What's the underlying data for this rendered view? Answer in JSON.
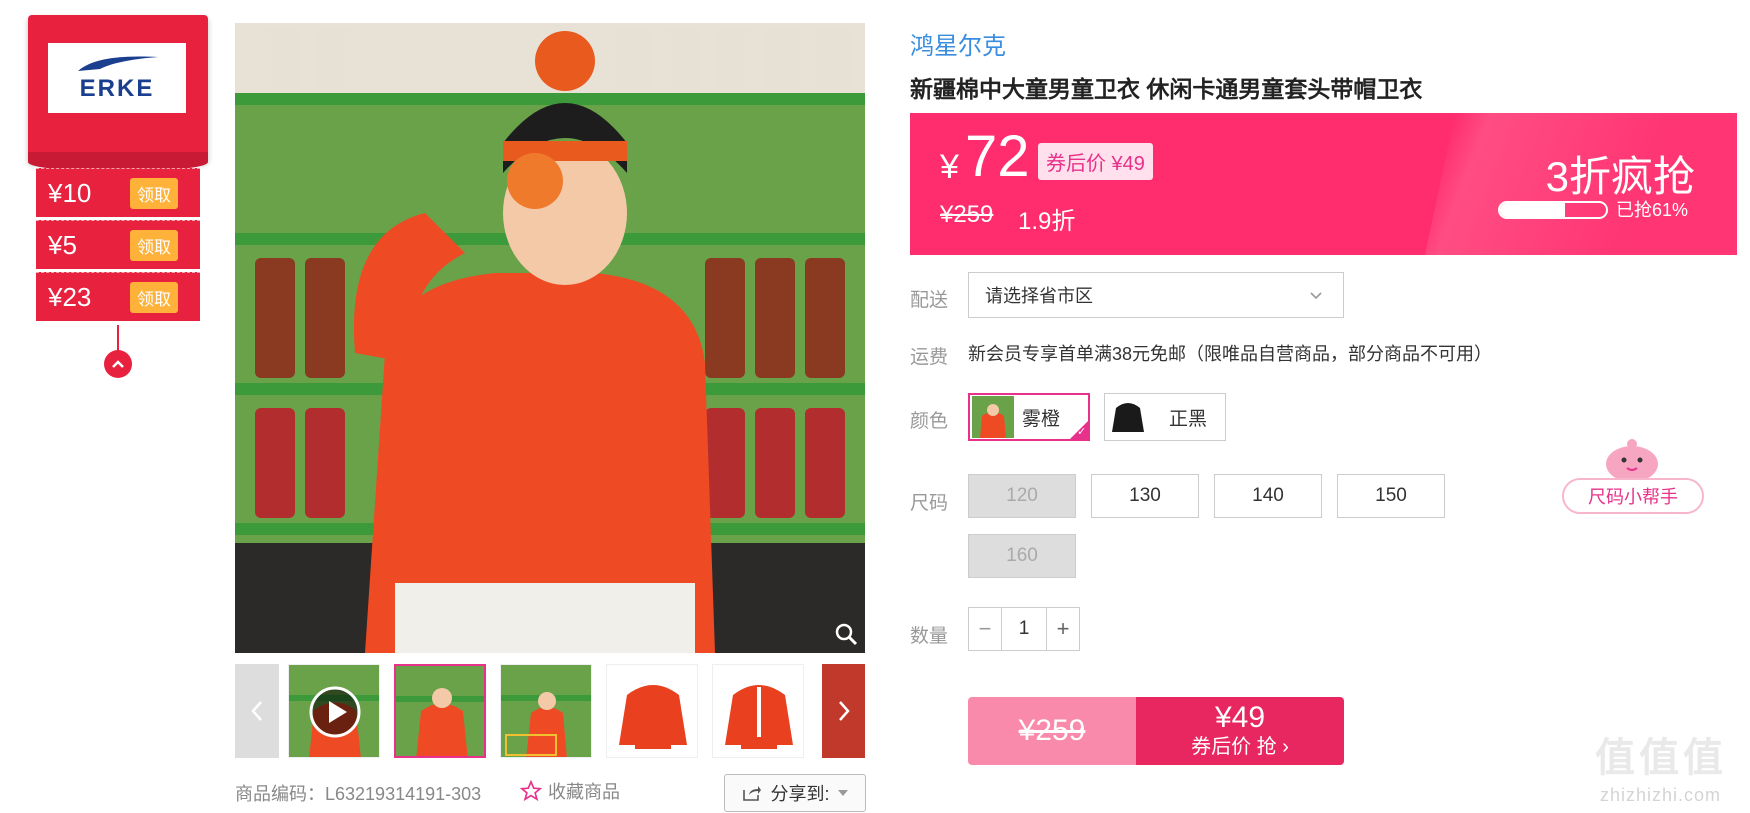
{
  "coupons": {
    "brand_logo_text": "ERKE",
    "items": [
      {
        "amount": "¥10",
        "action": "领取"
      },
      {
        "amount": "¥5",
        "action": "领取"
      },
      {
        "amount": "¥23",
        "action": "领取"
      }
    ]
  },
  "gallery": {
    "product_code": "商品编码：L63219314191-303",
    "favorite_label": "收藏商品",
    "share_label": "分享到:"
  },
  "product": {
    "brand": "鸿星尔克",
    "title": "新疆棉中大童男童卫衣 休闲卡通男童套头带帽卫衣"
  },
  "price": {
    "currency": "¥",
    "current": "72",
    "coupon_price": "券后价 ¥49",
    "original": "¥259",
    "discount": "1.9折",
    "promo": "3折疯抢",
    "sold_fraction": 0.61,
    "sold_text": "已抢61%"
  },
  "delivery": {
    "label": "配送",
    "placeholder": "请选择省市区"
  },
  "shipping": {
    "label": "运费",
    "text": "新会员专享首单满38元免邮（限唯品自营商品，部分商品不可用）"
  },
  "color": {
    "label": "颜色",
    "options": [
      {
        "name": "雾橙",
        "selected": true
      },
      {
        "name": "正黑",
        "selected": false
      }
    ]
  },
  "size": {
    "label": "尺码",
    "options": [
      "120",
      "130",
      "140",
      "150",
      "160"
    ],
    "disabled": [
      "120",
      "160"
    ],
    "helper": "尺码小帮手"
  },
  "quantity": {
    "label": "数量",
    "value": "1",
    "minus": "−",
    "plus": "+"
  },
  "buy": {
    "original": "¥259",
    "price": "¥49",
    "action": "券后价 抢 ›"
  },
  "watermark": {
    "main": "值值值",
    "sub": "zhizhizhi.com"
  },
  "colors": {
    "accent": "#ff2d6e",
    "coupon": "#e8213f",
    "brand_link": "#3a8dde",
    "pink": "#e8318a"
  }
}
